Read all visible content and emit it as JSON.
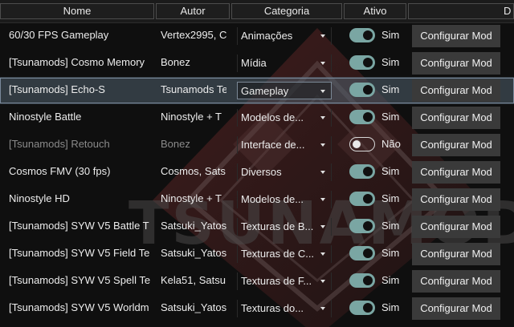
{
  "header": {
    "col_name": "Nome",
    "col_author": "Autor",
    "col_category": "Categoria",
    "col_active": "Ativo"
  },
  "watermark": {
    "text": "TSUNAMODS"
  },
  "colors": {
    "toggle_on": "#7aa6a3",
    "selection": "#50606e",
    "button": "#3a3a3a"
  },
  "mods": [
    {
      "name": "60/30 FPS Gameplay",
      "author": "Vertex2995, C",
      "category": "Animações",
      "active": true,
      "active_label": "Sim",
      "button": "Configurar Mod"
    },
    {
      "name": "[Tsunamods] Cosmo Memory",
      "author": "Bonez",
      "category": "Mídia",
      "active": true,
      "active_label": "Sim",
      "button": "Configurar Mod"
    },
    {
      "name": "[Tsunamods] Echo-S",
      "author": "Tsunamods Te",
      "category": "Gameplay",
      "active": true,
      "active_label": "Sim",
      "button": "Configurar Mod",
      "selected": true
    },
    {
      "name": "Ninostyle Battle",
      "author": "Ninostyle + T",
      "category": "Modelos de...",
      "active": true,
      "active_label": "Sim",
      "button": "Configurar Mod"
    },
    {
      "name": "[Tsunamods] Retouch",
      "author": "Bonez",
      "category": "Interface de...",
      "active": false,
      "active_label": "Não",
      "button": "Configurar Mod"
    },
    {
      "name": "Cosmos FMV (30 fps)",
      "author": "Cosmos, Sats",
      "category": "Diversos",
      "active": true,
      "active_label": "Sim",
      "button": "Configurar Mod"
    },
    {
      "name": "Ninostyle HD",
      "author": "Ninostyle + T",
      "category": "Modelos de...",
      "active": true,
      "active_label": "Sim",
      "button": "Configurar Mod"
    },
    {
      "name": "[Tsunamods] SYW V5 Battle T",
      "author": "Satsuki_Yatos",
      "category": "Texturas de B...",
      "active": true,
      "active_label": "Sim",
      "button": "Configurar Mod"
    },
    {
      "name": "[Tsunamods] SYW V5 Field Te",
      "author": "Satsuki_Yatos",
      "category": "Texturas de C...",
      "active": true,
      "active_label": "Sim",
      "button": "Configurar Mod"
    },
    {
      "name": "[Tsunamods] SYW V5 Spell Te",
      "author": "Kela51, Satsu",
      "category": "Texturas de F...",
      "active": true,
      "active_label": "Sim",
      "button": "Configurar Mod"
    },
    {
      "name": "[Tsunamods] SYW V5 Worldm",
      "author": "Satsuki_Yatos",
      "category": "Texturas do...",
      "active": true,
      "active_label": "Sim",
      "button": "Configurar Mod"
    }
  ]
}
